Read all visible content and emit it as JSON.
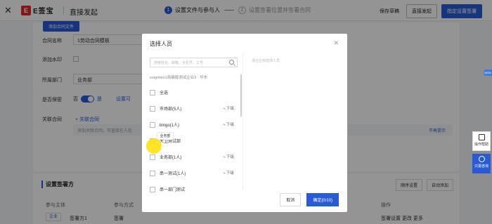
{
  "header": {
    "close_icon": "close-icon",
    "logo_mark": "E",
    "logo_text": "E签宝",
    "title": "直接发起",
    "steps": [
      {
        "num": "1",
        "label": "设置文件与参与人"
      },
      {
        "num": "2",
        "label": "设置签署位置并签署合同"
      }
    ],
    "save_draft": "保存草稿",
    "direct_start": "直接发起",
    "set_position": "指定设置签署"
  },
  "form": {
    "upload_label": "添加合同文件",
    "contract_name_label": "合同名称",
    "contract_name_value": "1劳动合同模板",
    "watermark_label": "添加水印",
    "dept_label": "所属部门",
    "dept_value": "业务部",
    "confidential_label": "是否保密",
    "confidential_no": "否",
    "confidential_yes": "是",
    "settings_link": "设置可",
    "related_label": "关联合同",
    "related_add": "+ 关联合同",
    "related_placeholder": "添加关联合同，可直接在人处",
    "related_right": "不再提示"
  },
  "signers": {
    "title": "设置签署方",
    "order_btn": "顺序设置",
    "auto_btn": "自动添加",
    "col_subject": "参与主体",
    "col_method": "参与方式",
    "col_action": "操作",
    "row_type": "企业",
    "row_name": "签署方1",
    "row_method": "签署",
    "row_actions": "签署设置  更改  更多"
  },
  "modal": {
    "title": "选择人员",
    "search_placeholder": "搜索姓名、邮箱、手机号、工号",
    "org_path": "esignites1商编版测试企业3 · 华东",
    "select_all": "全选",
    "items": [
      {
        "label": "市场部(5人)",
        "sub": "下级"
      },
      {
        "label": "bingo(1人)",
        "sub": "下级"
      },
      {
        "label": "大卫测试部",
        "sub": ""
      },
      {
        "label": "业务部(1人)",
        "sub": "下级"
      },
      {
        "label": "串一测试(1人)",
        "sub": "下级"
      },
      {
        "label": "串一部门测试",
        "sub": ""
      }
    ],
    "tooltip": "业务部",
    "right_placeholder": "请在左侧选择人员",
    "cancel": "取消",
    "ok": "确定(0/10)"
  },
  "floating": {
    "new_badge": "NEW",
    "help_label": "操作帮助",
    "consult_label": "只需咨询"
  }
}
